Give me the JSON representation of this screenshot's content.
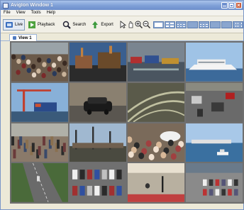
{
  "window": {
    "title": "AvigIon Window 1"
  },
  "menu": [
    "File",
    "View",
    "Tools",
    "Help"
  ],
  "toolbar": {
    "live_label": "Live",
    "playback_label": "Playback",
    "search_label": "Search",
    "export_label": "Export",
    "tools": [
      "pointer-icon",
      "pan-icon",
      "zoom-in-icon",
      "zoom-out-icon"
    ],
    "layouts": [
      "1x1",
      "2x2",
      "3x3",
      "4x4",
      "1+5",
      "1+7",
      "1+12",
      "2+8"
    ]
  },
  "tabs": [
    {
      "label": "View 1"
    }
  ],
  "cameras": [
    {
      "scene": "crowd"
    },
    {
      "scene": "industrial-plant"
    },
    {
      "scene": "port-containers"
    },
    {
      "scene": "cruise-ship"
    },
    {
      "scene": "container-crane"
    },
    {
      "scene": "parked-car"
    },
    {
      "scene": "rail-yard"
    },
    {
      "scene": "street-traffic"
    },
    {
      "scene": "crowd-street"
    },
    {
      "scene": "shipyard"
    },
    {
      "scene": "market-crowd"
    },
    {
      "scene": "harbor"
    },
    {
      "scene": "highway-overhead"
    },
    {
      "scene": "parking-lot"
    },
    {
      "scene": "plaza"
    },
    {
      "scene": "parking-aerial"
    }
  ],
  "colors": {
    "accent": "#4f7bc0",
    "titlebar": "#7e9fd6",
    "grid_border": "#6f6f6f"
  }
}
